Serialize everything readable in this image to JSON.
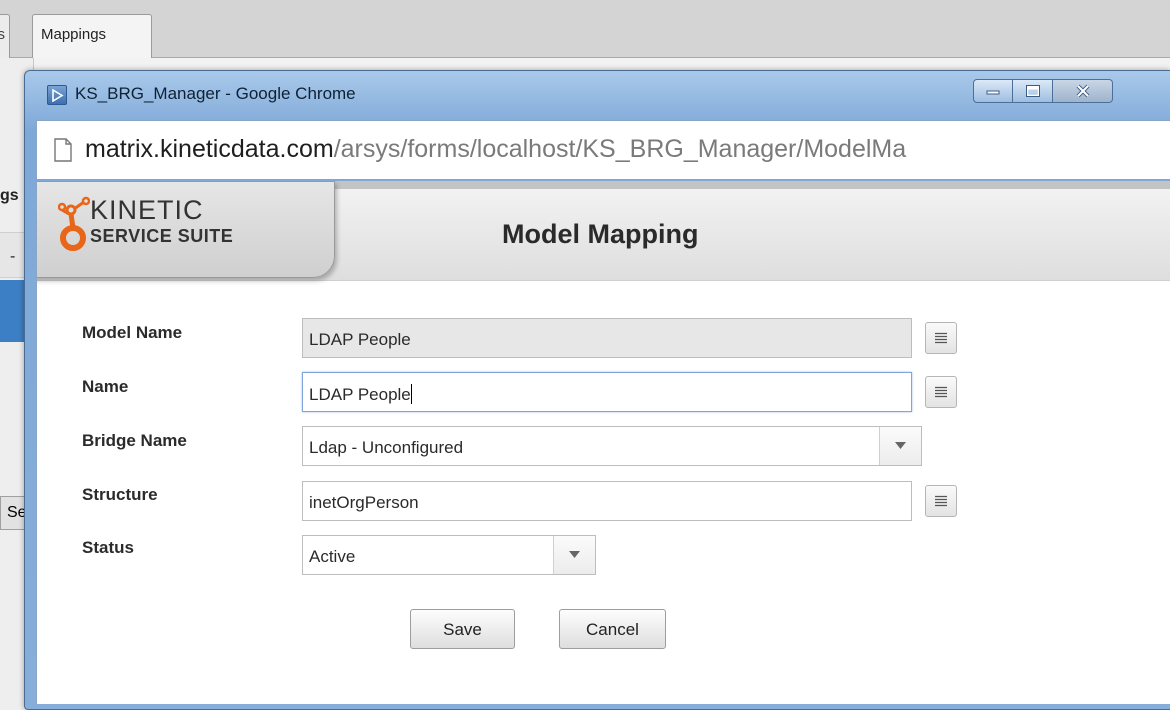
{
  "background_app": {
    "tabs": [
      {
        "label": "s"
      },
      {
        "label": "Mappings"
      }
    ],
    "fragments": {
      "heading": "gs",
      "dash": "-",
      "button": "Se"
    }
  },
  "window": {
    "title": "KS_BRG_Manager - Google Chrome",
    "controls": [
      "minimize",
      "maximize",
      "close"
    ]
  },
  "address_bar": {
    "domain": "matrix.kineticdata.com",
    "path": "/arsys/forms/localhost/KS_BRG_Manager/ModelMa"
  },
  "header": {
    "brand_line1": "KINETIC",
    "brand_line2": "SERVICE SUITE",
    "title": "Model Mapping"
  },
  "form": {
    "model_name": {
      "label": "Model Name",
      "value": "LDAP People",
      "readonly": true
    },
    "name": {
      "label": "Name",
      "value": "LDAP People",
      "focused": true
    },
    "bridge_name": {
      "label": "Bridge Name",
      "selected": "Ldap - Unconfigured"
    },
    "structure": {
      "label": "Structure",
      "value": "inetOrgPerson"
    },
    "status": {
      "label": "Status",
      "selected": "Active"
    }
  },
  "buttons": {
    "save": "Save",
    "cancel": "Cancel"
  },
  "colors": {
    "titlebar": "#7ea8d8",
    "focus_border": "#7fa6d6",
    "logo_orange": "#e8661a",
    "readonly_field": "#e7e7e7"
  }
}
